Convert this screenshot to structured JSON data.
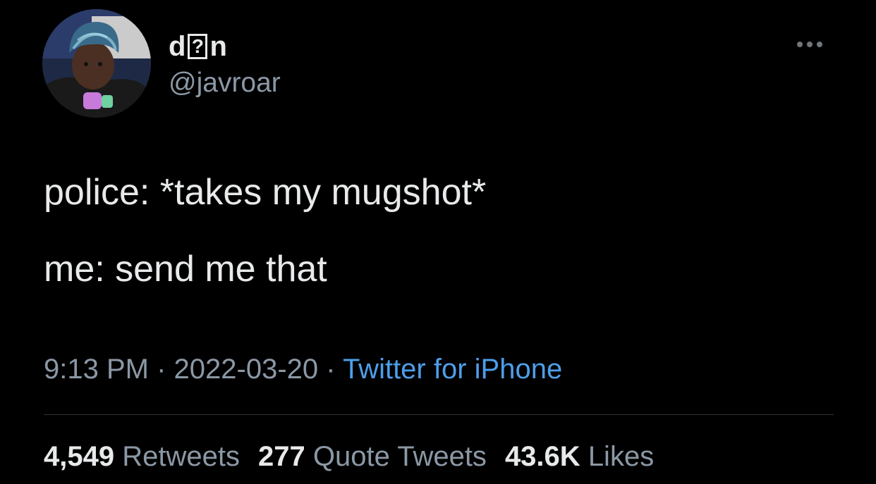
{
  "author": {
    "name_prefix": "d",
    "name_glyph": "?",
    "name_suffix": "n",
    "handle": "@javroar"
  },
  "tweet": {
    "line1": "police: *takes my mugshot*",
    "line2": "me: send me that"
  },
  "meta": {
    "time": "9:13 PM",
    "separator": " · ",
    "date": "2022-03-20",
    "source": "Twitter for iPhone"
  },
  "stats": {
    "retweets_count": "4,549",
    "retweets_label": "Retweets",
    "quotes_count": "277",
    "quotes_label": "Quote Tweets",
    "likes_count": "43.6K",
    "likes_label": "Likes"
  },
  "icons": {
    "more": "more-options-icon",
    "avatar": "avatar"
  },
  "colors": {
    "background": "#000000",
    "text": "#e7e9ea",
    "muted": "#8b98a5",
    "link": "#4e9eea",
    "divider": "#2f3336"
  }
}
